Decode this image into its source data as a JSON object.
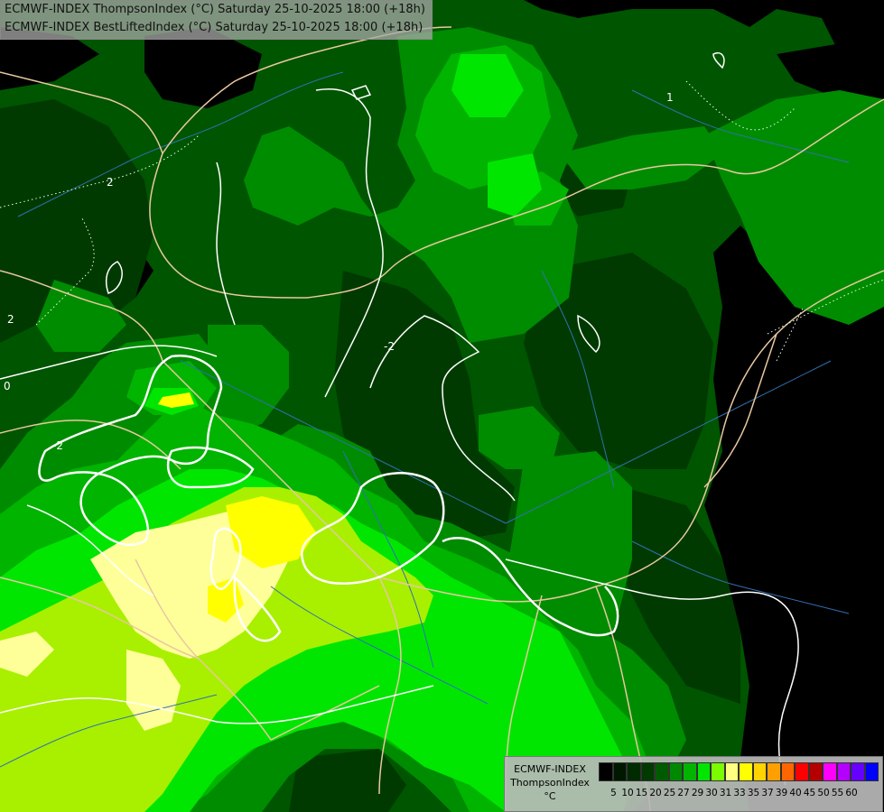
{
  "title": {
    "line1": "ECMWF-INDEX ThompsonIndex (°C) Saturday 25-10-2025 18:00 (+18h)",
    "line2": "ECMWF-INDEX BestLiftedIndex (°C) Saturday 25-10-2025 18:00 (+18h)"
  },
  "contour_labels": [
    {
      "text": "2"
    },
    {
      "text": "-2"
    },
    {
      "text": "2"
    },
    {
      "text": "0"
    },
    {
      "text": "-2"
    },
    {
      "text": "1"
    }
  ],
  "legend": {
    "model": "ECMWF-INDEX",
    "parameter": "ThompsonIndex",
    "unit": "°C",
    "colors": [
      "#000000",
      "#001800",
      "#002a00",
      "#003a00",
      "#005a00",
      "#008800",
      "#00b400",
      "#00e600",
      "#7bfc00",
      "#ffff80",
      "#ffff00",
      "#ffd400",
      "#ffa000",
      "#ff6600",
      "#ff0000",
      "#b40000",
      "#ff00ff",
      "#b400ff",
      "#6600ff",
      "#0000ff"
    ],
    "ticks": [
      "5",
      "10",
      "15",
      "20",
      "25",
      "27",
      "29",
      "30",
      "31",
      "33",
      "35",
      "37",
      "39",
      "40",
      "45",
      "50",
      "55",
      "60"
    ]
  },
  "colors": {
    "band_dark": "#003300",
    "band_mid": "#005500",
    "band_green": "#008800",
    "band_bright": "#00b400",
    "band_lime": "#00e000",
    "band_yellowgreen": "#a8f000",
    "band_paleyellow": "#ffff99",
    "band_yellow": "#ffff00",
    "border_color": "#e8c8a0",
    "river_color": "#3070b0",
    "contour_color": "#ffffff"
  }
}
